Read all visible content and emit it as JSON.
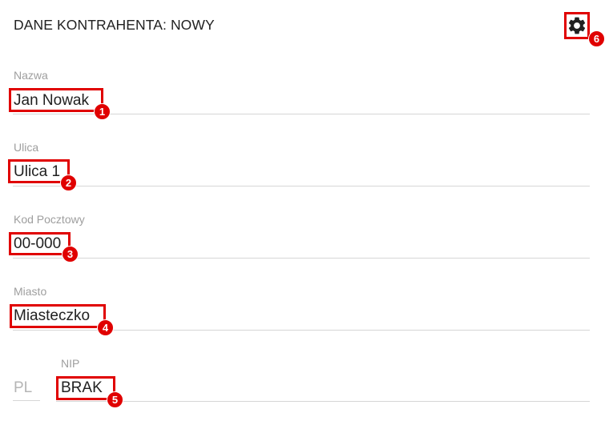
{
  "form": {
    "title": "DANE KONTRAHENTA: NOWY",
    "fields": {
      "nazwa": {
        "label": "Nazwa",
        "value": "Jan Nowak"
      },
      "ulica": {
        "label": "Ulica",
        "value": "Ulica 1"
      },
      "kod": {
        "label": "Kod Pocztowy",
        "value": "00-000"
      },
      "miasto": {
        "label": "Miasto",
        "value": "Miasteczko"
      },
      "nip": {
        "label": "NIP",
        "value": "BRAK",
        "prefix": "PL"
      }
    }
  },
  "annotations": {
    "b1": "1",
    "b2": "2",
    "b3": "3",
    "b4": "4",
    "b5": "5",
    "b6": "6"
  },
  "icons": {
    "settings": "gear-icon"
  },
  "colors": {
    "highlight": "#e00000",
    "label": "#9e9e9e",
    "text": "#212121"
  }
}
